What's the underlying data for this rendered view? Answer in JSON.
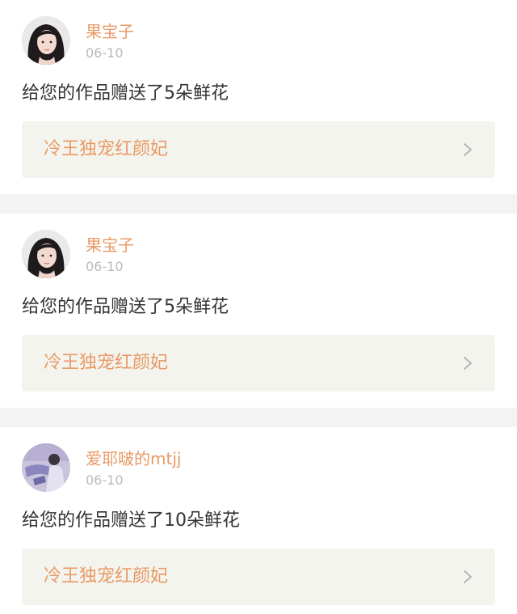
{
  "notifications": [
    {
      "username": "果宝子",
      "date": "06-10",
      "message": "给您的作品赠送了5朵鲜花",
      "work_title": "冷王独宠红颜妃",
      "avatar_icon": "avatar-girl-dark-hair"
    },
    {
      "username": "果宝子",
      "date": "06-10",
      "message": "给您的作品赠送了5朵鲜花",
      "work_title": "冷王独宠红颜妃",
      "avatar_icon": "avatar-girl-dark-hair"
    },
    {
      "username": "爱耶啵的mtjj",
      "date": "06-10",
      "message": "给您的作品赠送了10朵鲜花",
      "work_title": "冷王独宠红颜妃",
      "avatar_icon": "avatar-purple-figure"
    }
  ],
  "colors": {
    "accent": "#e89a66",
    "date": "#b9b9b9",
    "text": "#333333",
    "link_bg": "#f4f4ee",
    "separator": "#f3f3f3"
  }
}
